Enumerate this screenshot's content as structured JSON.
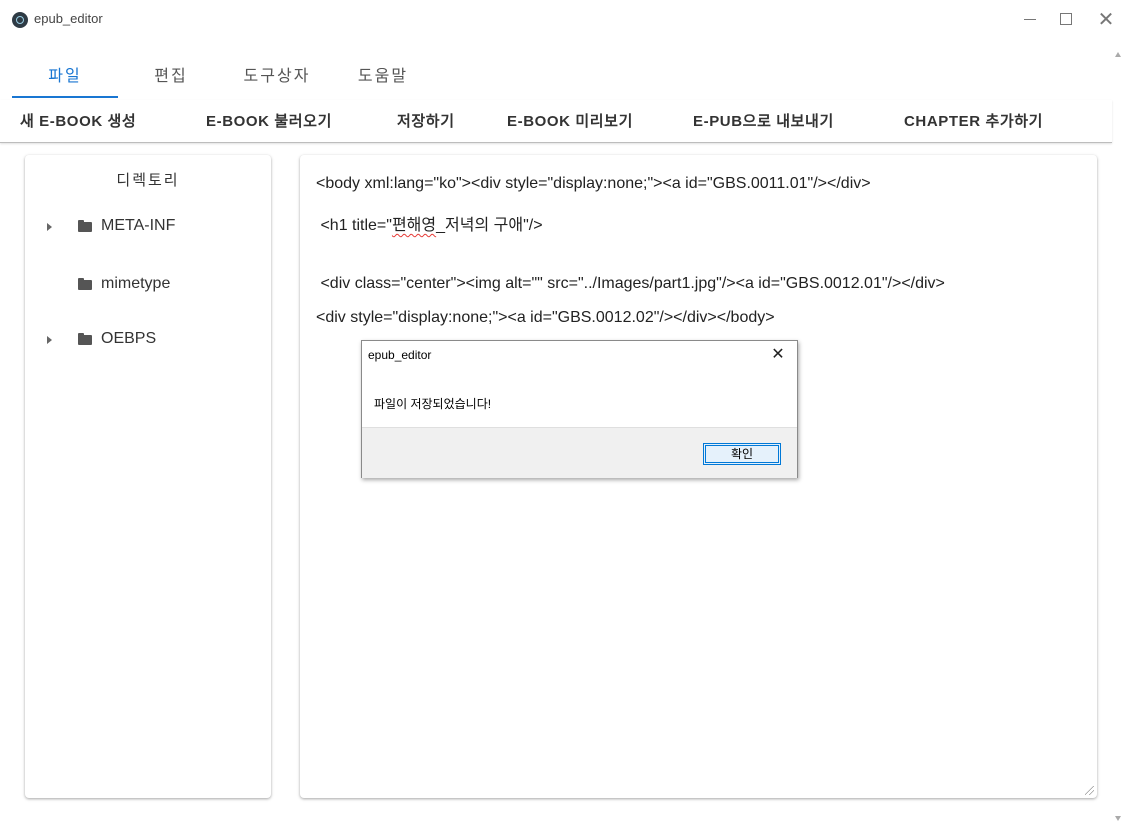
{
  "window": {
    "title": "epub_editor",
    "close_glyph": "✕"
  },
  "main_tabs": [
    {
      "label": "파일",
      "active": true
    },
    {
      "label": "편집",
      "active": false
    },
    {
      "label": "도구상자",
      "active": false
    },
    {
      "label": "도움말",
      "active": false
    }
  ],
  "toolbar": {
    "new_ebook": "새 E-BOOK 생성",
    "load_ebook": "E-BOOK 불러오기",
    "save": "저장하기",
    "preview": "E-BOOK 미리보기",
    "export_epub": "E-PUB으로 내보내기",
    "add_chapter": "CHAPTER 추가하기"
  },
  "directory": {
    "title": "디렉토리",
    "items": [
      {
        "label": "META-INF",
        "expandable": true,
        "icon": "folder-icon"
      },
      {
        "label": "mimetype",
        "expandable": false,
        "icon": "folder-icon"
      },
      {
        "label": "OEBPS",
        "expandable": true,
        "icon": "folder-icon"
      }
    ]
  },
  "editor": {
    "line1": "<body xml:lang=\"ko\"><div style=\"display:none;\"><a id=\"GBS.0011.01\"/></div>",
    "line2_prefix": " <h1 title=\"",
    "line2_misspelled": "편해영",
    "line2_suffix": "_저녁의 구애\"/>",
    "line3": " <div class=\"center\"><img alt=\"\" src=\"../Images/part1.jpg\"/><a id=\"GBS.0012.01\"/></div>",
    "line4": "<div style=\"display:none;\"><a id=\"GBS.0012.02\"/></div></body>"
  },
  "dialog": {
    "title": "epub_editor",
    "close_glyph": "✕",
    "message": "파일이 저장되었습니다!",
    "ok_label": "확인"
  },
  "colors": {
    "accent": "#1976d2",
    "dialog_footer": "#f0f0f0",
    "ok_border": "#0078d7"
  }
}
